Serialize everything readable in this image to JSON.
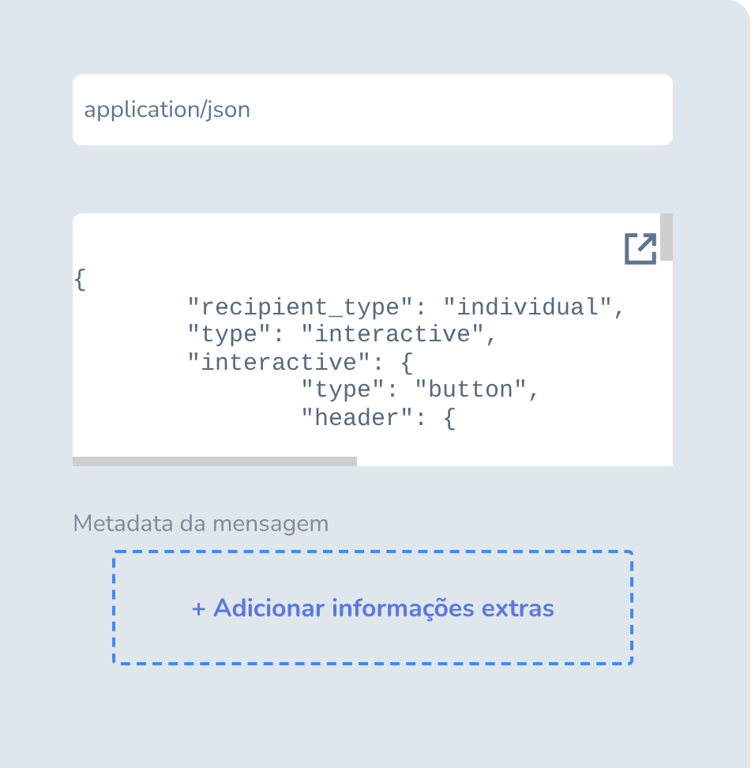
{
  "content_type_field": {
    "value": "application/json"
  },
  "code_editor": {
    "lines": [
      "{",
      "\t\"recipient_type\": \"individual\",",
      "\t\"type\": \"interactive\",",
      "\t\"interactive\": {",
      "\t\t\"type\": \"button\",",
      "\t\t\"header\": {"
    ]
  },
  "metadata": {
    "label": "Metadata da mensagem",
    "add_button": "+ Adicionar informações extras"
  }
}
